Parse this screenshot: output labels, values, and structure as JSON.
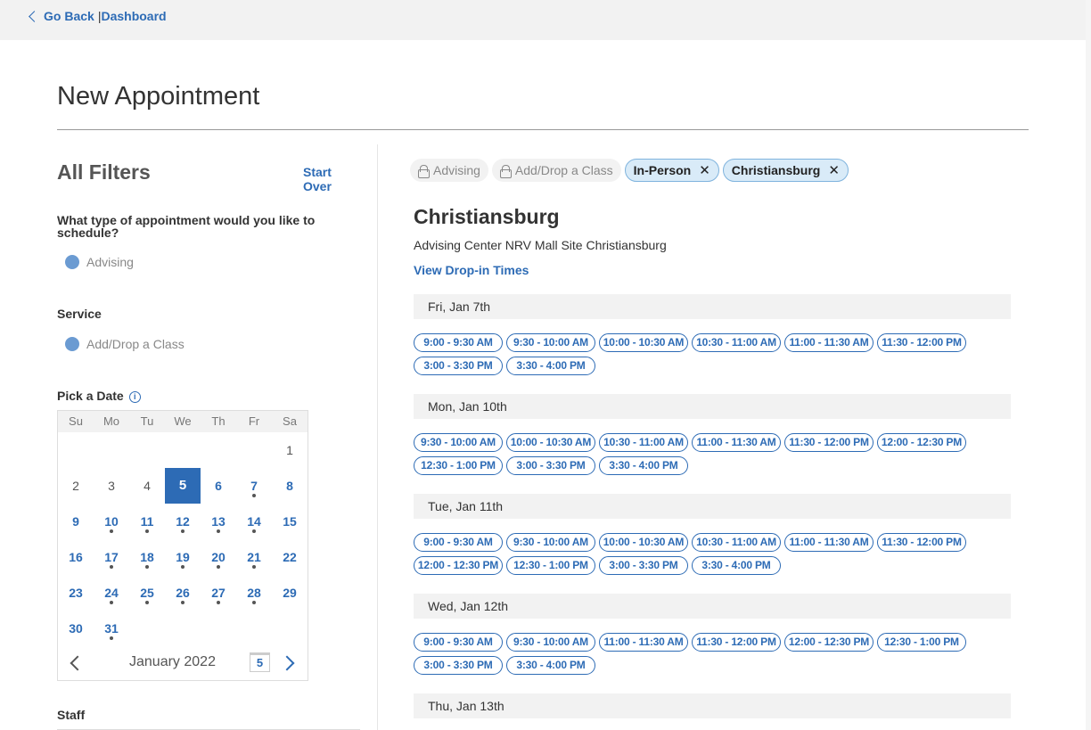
{
  "topbar": {
    "back_label": "Go Back",
    "separator": "|",
    "dashboard_label": "Dashboard"
  },
  "page_title": "New Appointment",
  "filters": {
    "title": "All Filters",
    "start_over": "Start Over",
    "appointment_question": "What type of appointment would you like to schedule?",
    "appointment_value": "Advising",
    "service_label": "Service",
    "service_value": "Add/Drop a Class",
    "pick_date_label": "Pick a Date",
    "info_icon": "i",
    "staff_label": "Staff"
  },
  "calendar": {
    "weekdays": [
      "Su",
      "Mo",
      "Tu",
      "We",
      "Th",
      "Fr",
      "Sa"
    ],
    "month_label": "January 2022",
    "today_badge": "5",
    "selected_day": "5",
    "days": [
      {
        "d": "1",
        "col": 6,
        "row": 0,
        "avail": false,
        "dot": false
      },
      {
        "d": "2",
        "col": 0,
        "row": 1,
        "avail": false,
        "dot": false
      },
      {
        "d": "3",
        "col": 1,
        "row": 1,
        "avail": false,
        "dot": false
      },
      {
        "d": "4",
        "col": 2,
        "row": 1,
        "avail": false,
        "dot": false
      },
      {
        "d": "5",
        "col": 3,
        "row": 1,
        "avail": true,
        "dot": false
      },
      {
        "d": "6",
        "col": 4,
        "row": 1,
        "avail": true,
        "dot": false
      },
      {
        "d": "7",
        "col": 5,
        "row": 1,
        "avail": true,
        "dot": true
      },
      {
        "d": "8",
        "col": 6,
        "row": 1,
        "avail": true,
        "dot": false
      },
      {
        "d": "9",
        "col": 0,
        "row": 2,
        "avail": true,
        "dot": false
      },
      {
        "d": "10",
        "col": 1,
        "row": 2,
        "avail": true,
        "dot": true
      },
      {
        "d": "11",
        "col": 2,
        "row": 2,
        "avail": true,
        "dot": true
      },
      {
        "d": "12",
        "col": 3,
        "row": 2,
        "avail": true,
        "dot": true
      },
      {
        "d": "13",
        "col": 4,
        "row": 2,
        "avail": true,
        "dot": true
      },
      {
        "d": "14",
        "col": 5,
        "row": 2,
        "avail": true,
        "dot": true
      },
      {
        "d": "15",
        "col": 6,
        "row": 2,
        "avail": true,
        "dot": false
      },
      {
        "d": "16",
        "col": 0,
        "row": 3,
        "avail": true,
        "dot": false
      },
      {
        "d": "17",
        "col": 1,
        "row": 3,
        "avail": true,
        "dot": true
      },
      {
        "d": "18",
        "col": 2,
        "row": 3,
        "avail": true,
        "dot": true
      },
      {
        "d": "19",
        "col": 3,
        "row": 3,
        "avail": true,
        "dot": true
      },
      {
        "d": "20",
        "col": 4,
        "row": 3,
        "avail": true,
        "dot": true
      },
      {
        "d": "21",
        "col": 5,
        "row": 3,
        "avail": true,
        "dot": true
      },
      {
        "d": "22",
        "col": 6,
        "row": 3,
        "avail": true,
        "dot": false
      },
      {
        "d": "23",
        "col": 0,
        "row": 4,
        "avail": true,
        "dot": false
      },
      {
        "d": "24",
        "col": 1,
        "row": 4,
        "avail": true,
        "dot": true
      },
      {
        "d": "25",
        "col": 2,
        "row": 4,
        "avail": true,
        "dot": true
      },
      {
        "d": "26",
        "col": 3,
        "row": 4,
        "avail": true,
        "dot": true
      },
      {
        "d": "27",
        "col": 4,
        "row": 4,
        "avail": true,
        "dot": true
      },
      {
        "d": "28",
        "col": 5,
        "row": 4,
        "avail": true,
        "dot": true
      },
      {
        "d": "29",
        "col": 6,
        "row": 4,
        "avail": true,
        "dot": false
      },
      {
        "d": "30",
        "col": 0,
        "row": 5,
        "avail": true,
        "dot": false
      },
      {
        "d": "31",
        "col": 1,
        "row": 5,
        "avail": true,
        "dot": true
      }
    ]
  },
  "chips": [
    {
      "label": "Advising",
      "locked": true
    },
    {
      "label": "Add/Drop a Class",
      "locked": true
    },
    {
      "label": "In-Person",
      "locked": false
    },
    {
      "label": "Christiansburg",
      "locked": false
    }
  ],
  "location": {
    "title": "Christiansburg",
    "subtitle": "Advising Center NRV Mall Site Christiansburg",
    "drop_in_link": "View Drop-in Times"
  },
  "days": [
    {
      "label": "Fri, Jan 7th",
      "slots": [
        "9:00 - 9:30 AM",
        "9:30 - 10:00 AM",
        "10:00 - 10:30 AM",
        "10:30 - 11:00 AM",
        "11:00 - 11:30 AM",
        "11:30 - 12:00 PM",
        "3:00 - 3:30 PM",
        "3:30 - 4:00 PM"
      ]
    },
    {
      "label": "Mon, Jan 10th",
      "slots": [
        "9:30 - 10:00 AM",
        "10:00 - 10:30 AM",
        "10:30 - 11:00 AM",
        "11:00 - 11:30 AM",
        "11:30 - 12:00 PM",
        "12:00 - 12:30 PM",
        "12:30 - 1:00 PM",
        "3:00 - 3:30 PM",
        "3:30 - 4:00 PM"
      ]
    },
    {
      "label": "Tue, Jan 11th",
      "slots": [
        "9:00 - 9:30 AM",
        "9:30 - 10:00 AM",
        "10:00 - 10:30 AM",
        "10:30 - 11:00 AM",
        "11:00 - 11:30 AM",
        "11:30 - 12:00 PM",
        "12:00 - 12:30 PM",
        "12:30 - 1:00 PM",
        "3:00 - 3:30 PM",
        "3:30 - 4:00 PM"
      ]
    },
    {
      "label": "Wed, Jan 12th",
      "slots": [
        "9:00 - 9:30 AM",
        "9:30 - 10:00 AM",
        "11:00 - 11:30 AM",
        "11:30 - 12:00 PM",
        "12:00 - 12:30 PM",
        "12:30 - 1:00 PM",
        "3:00 - 3:30 PM",
        "3:30 - 4:00 PM"
      ]
    },
    {
      "label": "Thu, Jan 13th",
      "slots": []
    }
  ]
}
